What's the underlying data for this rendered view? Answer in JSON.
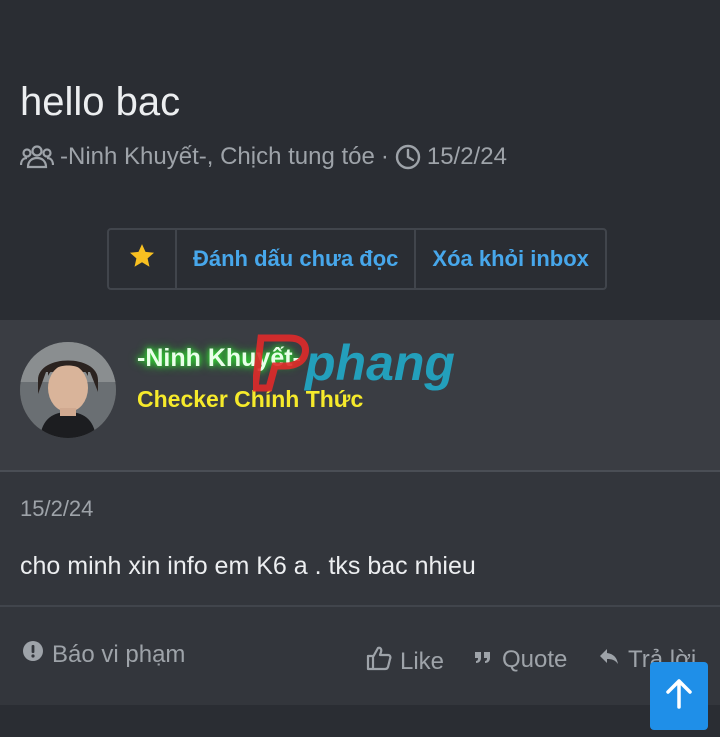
{
  "thread": {
    "title": "hello bac",
    "participants": "-Ninh Khuyết-, Chịch tung tóe",
    "separator": "·",
    "date": "15/2/24"
  },
  "actions": {
    "star_icon": "star-icon",
    "mark_unread": "Đánh dấu chưa đọc",
    "remove_inbox": "Xóa khỏi inbox"
  },
  "post": {
    "author": "-Ninh Khuyết-",
    "author_title": "Checker Chính Thức",
    "watermark": "Phang",
    "date": "15/2/24",
    "message": "cho minh xin info em K6 a . tks bac nhieu"
  },
  "footer": {
    "report": "Báo vi phạm",
    "like": "Like",
    "quote": "Quote",
    "reply": "Trả lời"
  },
  "colors": {
    "background": "#2a2d33",
    "accent": "#47a7eb",
    "username_glow": "#2fe52f",
    "user_title": "#f6ea2b",
    "scroll_button": "#1f8fe8"
  }
}
